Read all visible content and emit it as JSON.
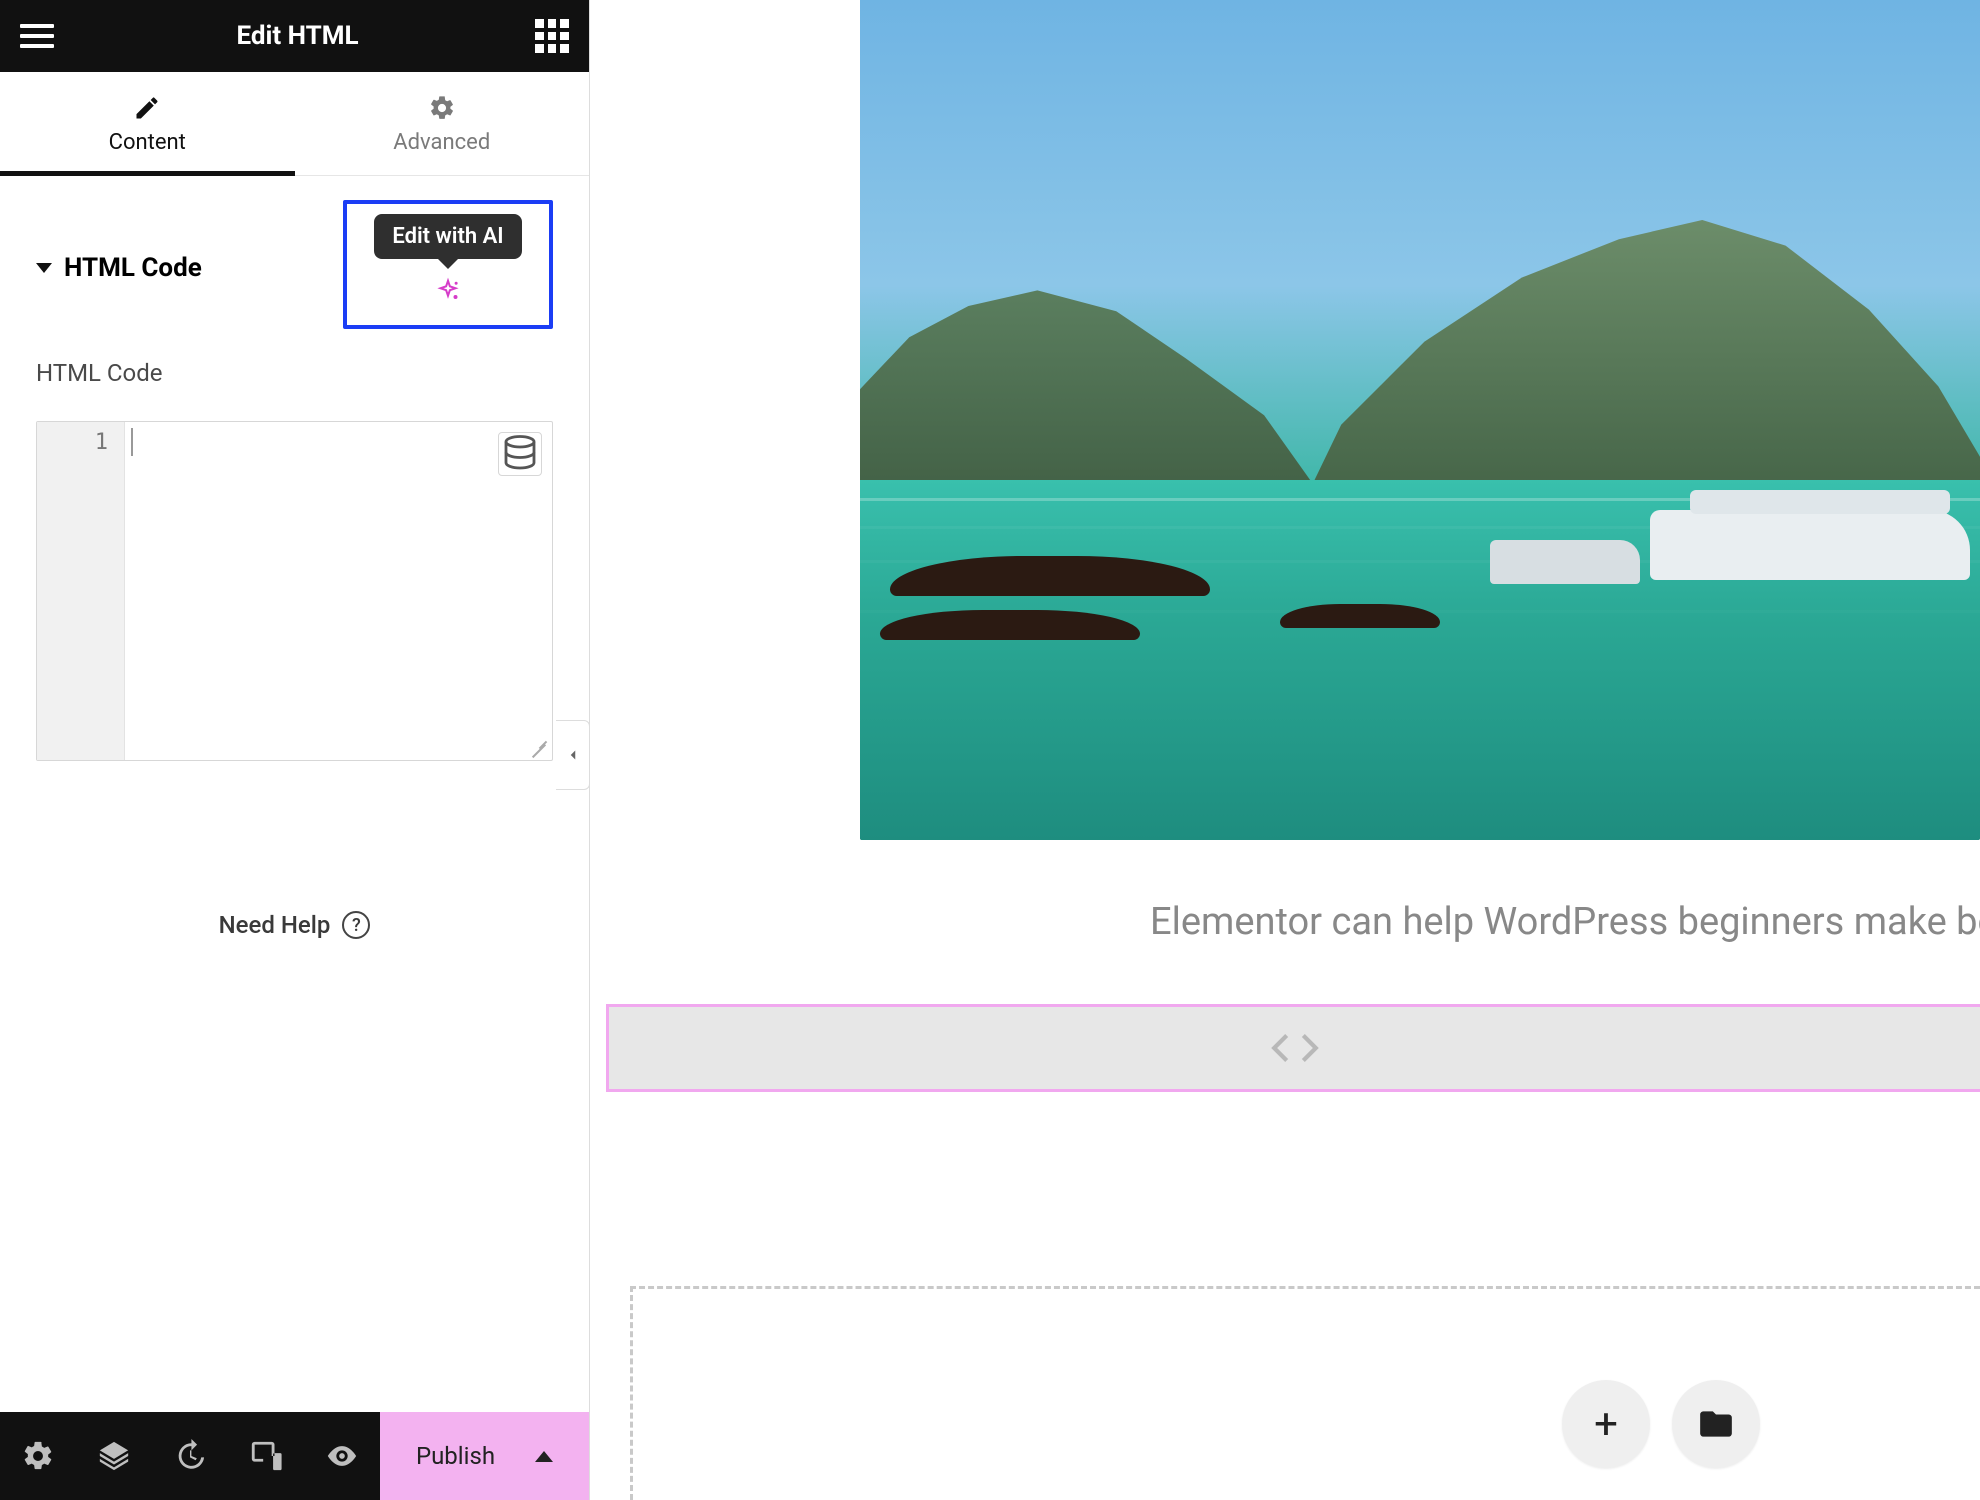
{
  "header": {
    "title": "Edit HTML"
  },
  "tabs": {
    "content": "Content",
    "advanced": "Advanced"
  },
  "section": {
    "title": "HTML Code",
    "field_label": "HTML Code"
  },
  "ai": {
    "tooltip": "Edit with AI"
  },
  "editor": {
    "line1": "1"
  },
  "help": {
    "label": "Need Help",
    "mark": "?"
  },
  "footer": {
    "publish": "Publish"
  },
  "canvas": {
    "caption": "Elementor can help WordPress beginners make beautif",
    "add_button": "+"
  }
}
